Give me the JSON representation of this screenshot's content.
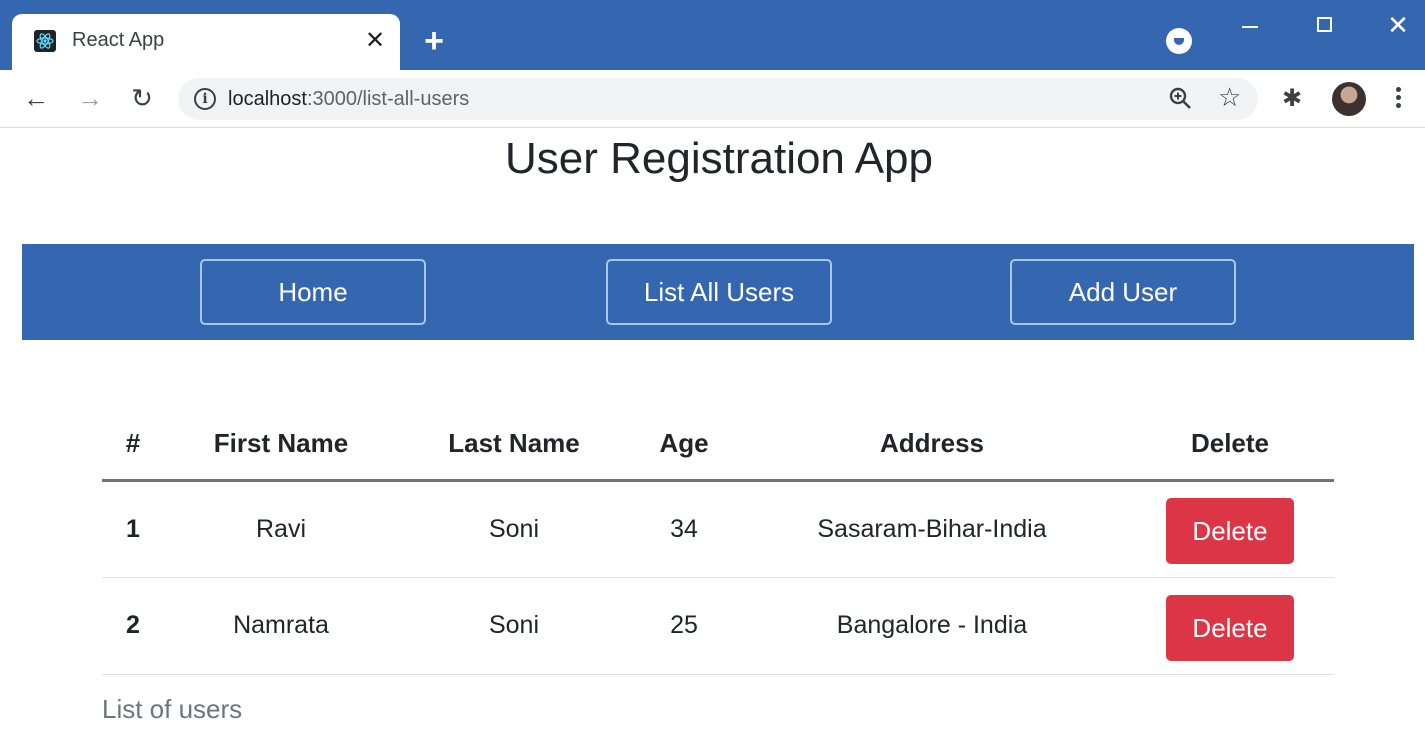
{
  "browser": {
    "tab_title": "React App",
    "url_host": "localhost",
    "url_rest": ":3000/list-all-users",
    "colors": {
      "chrome": "#3567b0",
      "navbar": "#3567b0",
      "delete": "#dc3545"
    }
  },
  "page": {
    "title": "User Registration App",
    "nav": {
      "home": "Home",
      "list_all": "List All Users",
      "add_user": "Add User"
    },
    "table": {
      "headers": [
        "#",
        "First Name",
        "Last Name",
        "Age",
        "Address",
        "Delete"
      ],
      "rows": [
        {
          "idx": "1",
          "first": "Ravi",
          "last": "Soni",
          "age": "34",
          "address": "Sasaram-Bihar-India",
          "action": "Delete"
        },
        {
          "idx": "2",
          "first": "Namrata",
          "last": "Soni",
          "age": "25",
          "address": "Bangalore - India",
          "action": "Delete"
        }
      ],
      "caption": "List of users"
    }
  }
}
